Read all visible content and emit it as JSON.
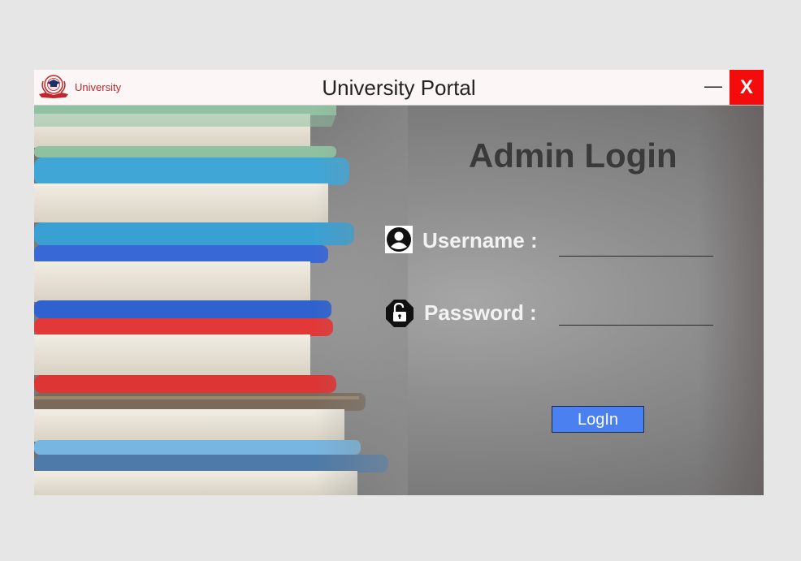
{
  "window": {
    "brand": "University",
    "title": "University Portal",
    "minimize_label": "—",
    "close_label": "X"
  },
  "login": {
    "heading": "Admin Login",
    "username_label": "Username :",
    "password_label": "Password :",
    "username_value": "",
    "password_value": "",
    "button_label": "LogIn"
  },
  "icons": {
    "logo": "university-crest-icon",
    "username": "user-icon",
    "password": "lock-icon"
  },
  "colors": {
    "close": "#f40b0b",
    "login_button": "#4a80f0",
    "brand_text": "#c0262b"
  }
}
